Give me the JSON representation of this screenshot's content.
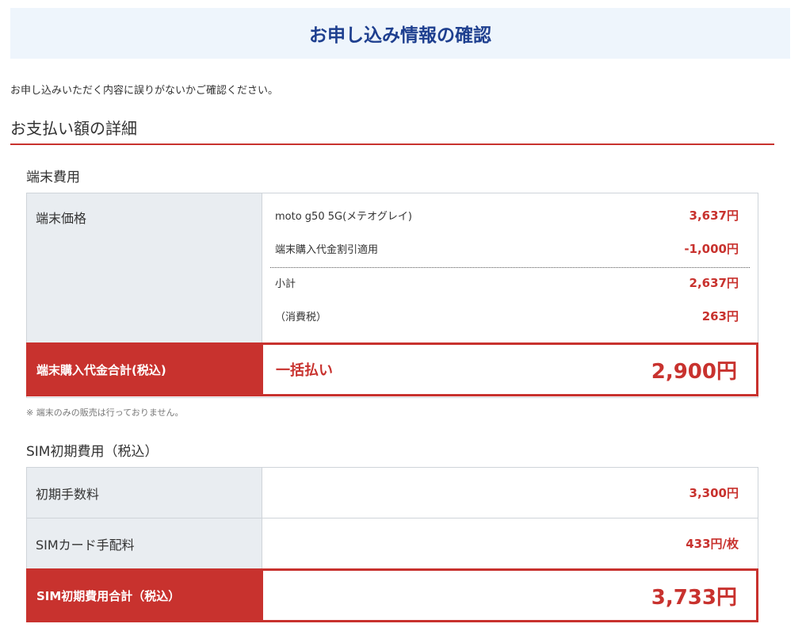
{
  "page_title": "お申し込み情報の確認",
  "intro": "お申し込みいただく内容に誤りがないかご確認ください。",
  "section_heading": "お支払い額の詳細",
  "device": {
    "heading": "端末費用",
    "price_label": "端末価格",
    "items": [
      {
        "name": "moto g50 5G(メテオグレイ)",
        "price": "3,637円"
      },
      {
        "name": "端末購入代金割引適用",
        "price": "-1,000円"
      },
      {
        "name": "小計",
        "price": "2,637円"
      },
      {
        "name": "（消費税）",
        "price": "263円"
      }
    ],
    "total_label": "端末購入代金合計(税込)",
    "total_method": "一括払い",
    "total_amount": "2,900円",
    "note": "※ 端末のみの販売は行っておりません。"
  },
  "sim": {
    "heading": "SIM初期費用（税込）",
    "rows": [
      {
        "label": "初期手数料",
        "value": "3,300円"
      },
      {
        "label": "SIMカード手配料",
        "value": "433円/枚"
      }
    ],
    "total_label": "SIM初期費用合計（税込）",
    "total_amount": "3,733円"
  },
  "colors": {
    "accent_red": "#c8322e",
    "title_blue": "#1e3f8f",
    "title_bg": "#eef5fc",
    "label_bg": "#e9edf1"
  }
}
